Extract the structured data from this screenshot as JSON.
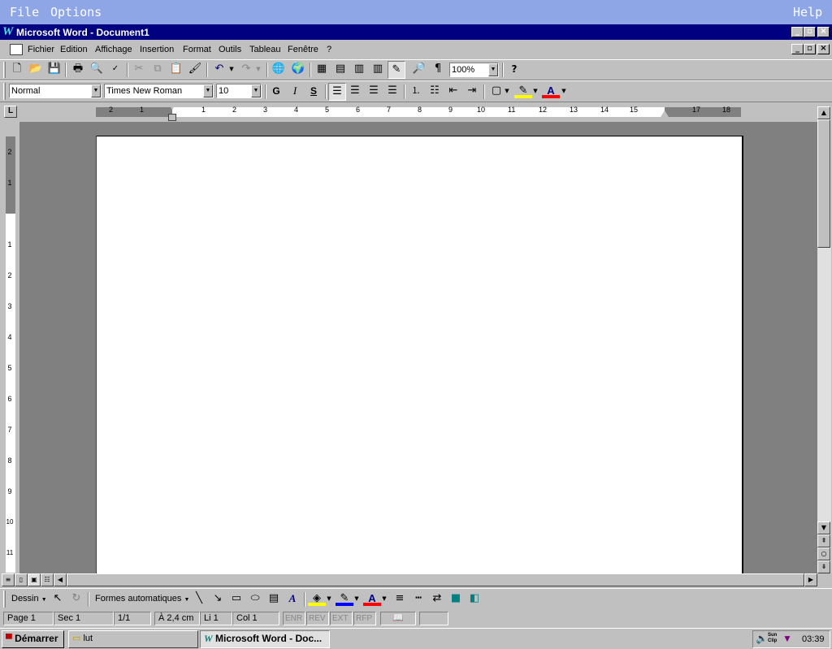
{
  "topbar": {
    "file": "File",
    "options": "Options",
    "help": "Help"
  },
  "window": {
    "title": "Microsoft Word - Document1",
    "app_icon": "W"
  },
  "menu": [
    "Fichier",
    "Edition",
    "Affichage",
    "Insertion",
    "Format",
    "Outils",
    "Tableau",
    "Fenêtre",
    "?"
  ],
  "toolbar": {
    "zoom": "100%"
  },
  "format": {
    "style": "Normal",
    "font": "Times New Roman",
    "size": "10",
    "bold": "G",
    "italic": "I",
    "underline": "S"
  },
  "ruler": {
    "h_ticks": [
      "2",
      "1",
      "1",
      "2",
      "3",
      "4",
      "5",
      "6",
      "7",
      "8",
      "9",
      "10",
      "11",
      "12",
      "13",
      "14",
      "15",
      "17",
      "18"
    ],
    "v_ticks": [
      "2",
      "1",
      "1",
      "1",
      "2",
      "3",
      "4",
      "5",
      "6",
      "7",
      "8",
      "9",
      "10",
      "11"
    ]
  },
  "drawing": {
    "dessin": "Dessin",
    "formes": "Formes automatiques"
  },
  "status": {
    "page": "Page 1",
    "sec": "Sec 1",
    "pages": "1/1",
    "at": "À 2,4 cm",
    "li": "Li 1",
    "col": "Col 1",
    "enr": "ENR",
    "rev": "REV",
    "ext": "EXT",
    "rfp": "RFP"
  },
  "taskbar": {
    "start": "Démarrer",
    "folder": "lut",
    "word": "Microsoft Word - Doc...",
    "tray_app": "Sun Clip",
    "clock": "03:39"
  },
  "colors": {
    "titlebar": "#000080",
    "topbar": "#8fa6e6",
    "desktop": "#808080"
  }
}
